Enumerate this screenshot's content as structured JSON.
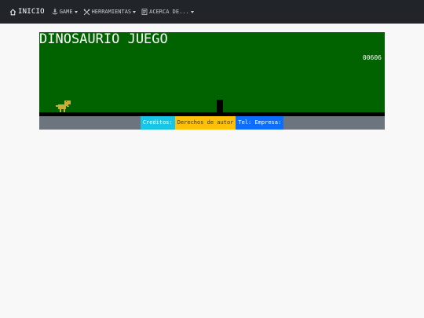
{
  "navbar": {
    "brand_label": "INICIO",
    "items": [
      {
        "label": "GAME",
        "icon": "anchor-icon"
      },
      {
        "label": "HERRAMIENTAS",
        "icon": "tools-icon"
      },
      {
        "label": "ACERCA DE...",
        "icon": "document-icon"
      }
    ]
  },
  "game": {
    "title": "DINOSAURIO JUEGO",
    "score": "00606",
    "colors": {
      "sky": "#006300",
      "ground": "#000000",
      "dino": "#c4b037"
    }
  },
  "footer": {
    "credits": "Creditos:",
    "rights": "Derechos de autor",
    "contact": "Tel: Empresa:",
    "colors": {
      "credits": "#17c5e6",
      "rights": "#ffc107",
      "contact": "#0d6efd"
    }
  }
}
